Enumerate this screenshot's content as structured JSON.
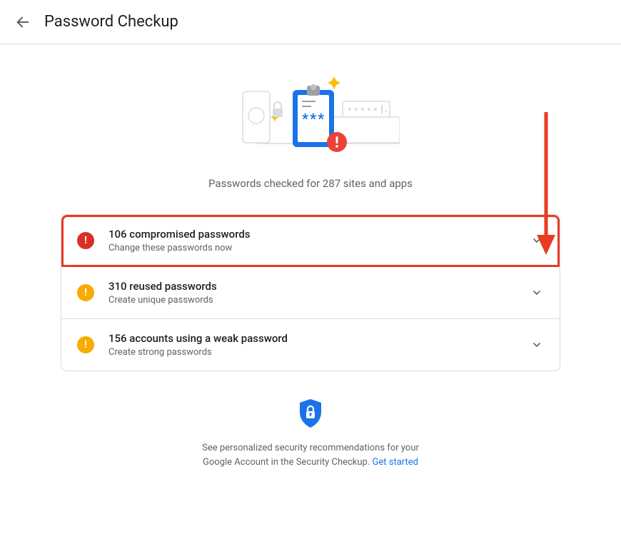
{
  "header": {
    "title": "Password Checkup"
  },
  "summary": "Passwords checked for 287 sites and apps",
  "rows": [
    {
      "title": "106 compromised passwords",
      "subtitle": "Change these passwords now",
      "severity": "red",
      "highlighted": true
    },
    {
      "title": "310 reused passwords",
      "subtitle": "Create unique passwords",
      "severity": "yellow",
      "highlighted": false
    },
    {
      "title": "156 accounts using a weak password",
      "subtitle": "Create strong passwords",
      "severity": "yellow",
      "highlighted": false
    }
  ],
  "footer": {
    "text_part1": "See personalized security recommendations for your Google Account in the Security Checkup. ",
    "link_text": "Get started"
  }
}
